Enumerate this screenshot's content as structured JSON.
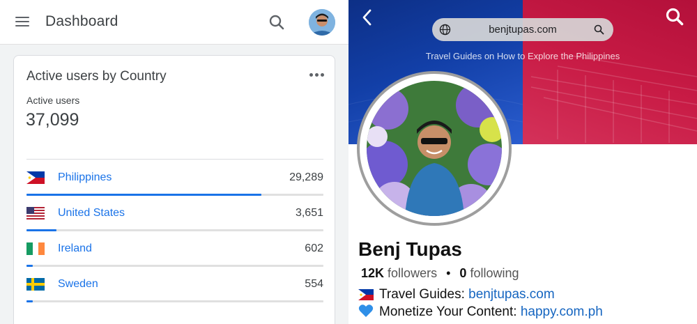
{
  "analytics": {
    "app_title": "Dashboard",
    "card": {
      "title": "Active users by Country",
      "metric_label": "Active users",
      "metric_value": "37,099",
      "rows": [
        {
          "country": "Philippines",
          "count": "29,289",
          "share": 0.79,
          "flag": "PH"
        },
        {
          "country": "United States",
          "count": "3,651",
          "share": 0.1,
          "flag": "US"
        },
        {
          "country": "Ireland",
          "count": "602",
          "share": 0.02,
          "flag": "IE"
        },
        {
          "country": "Sweden",
          "count": "554",
          "share": 0.02,
          "flag": "SE"
        }
      ]
    },
    "colors": {
      "accent": "#1a73e8",
      "track": "#e0e0e0"
    },
    "icons": [
      "menu-icon",
      "search-icon",
      "avatar",
      "more-vert-icon"
    ]
  },
  "profile": {
    "url": "benjtupas.com",
    "tagline": "Travel Guides on How to Explore the Philippines",
    "name": "Benj Tupas",
    "followers_count": "12K",
    "followers_label": "followers",
    "following_count": "0",
    "following_label": "following",
    "bio": [
      {
        "emoji": "ph-flag",
        "text": "Travel Guides: ",
        "link": "benjtupas.com"
      },
      {
        "emoji": "blue-heart",
        "text": "Monetize Your Content: ",
        "link": "happy.com.ph"
      }
    ],
    "colors": {
      "link": "#1565c0",
      "banner_blue": "#123fa7",
      "banner_red": "#c81b45"
    },
    "icons": [
      "back-icon",
      "search-icon",
      "globe-icon"
    ]
  }
}
